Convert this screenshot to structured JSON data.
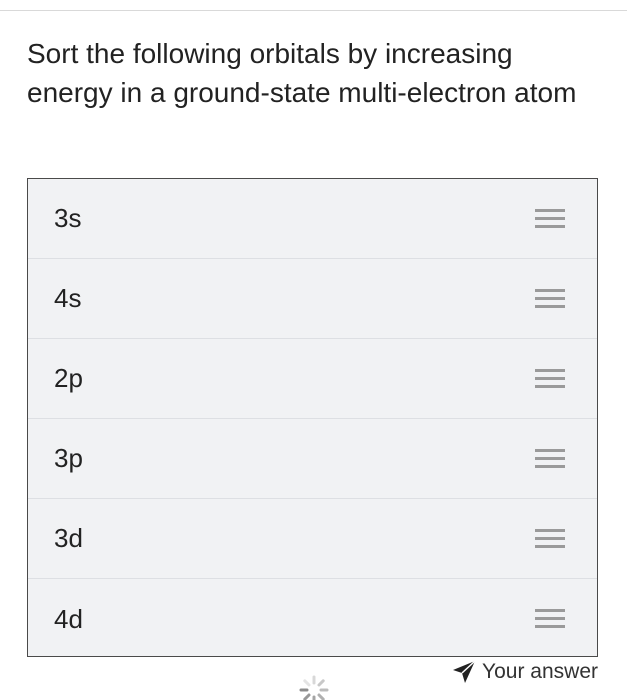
{
  "question": {
    "text": "Sort the following orbitals by increasing energy in a ground-state multi-electron atom"
  },
  "items": [
    {
      "label": "3s"
    },
    {
      "label": "4s"
    },
    {
      "label": "2p"
    },
    {
      "label": "3p"
    },
    {
      "label": "3d"
    },
    {
      "label": "4d"
    }
  ],
  "answer": {
    "label": "Your answer",
    "icon": "send-icon"
  },
  "loading": {
    "icon": "spinner-icon"
  },
  "colors": {
    "list_background": "#f1f2f4",
    "list_border": "#4a4a4a",
    "handle": "#9a9a9a",
    "text": "#222222"
  }
}
